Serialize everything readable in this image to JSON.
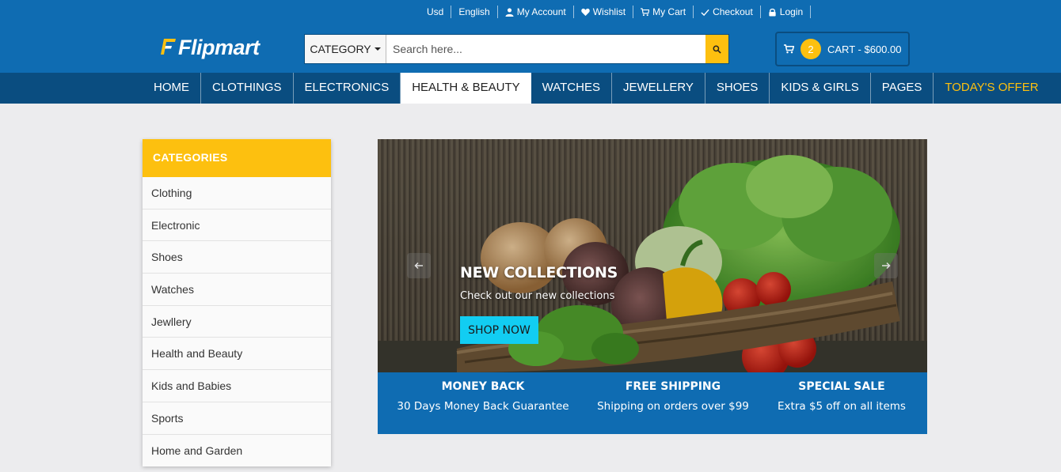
{
  "top_links": {
    "currency": "Usd",
    "language": "English",
    "my_account": "My Account",
    "wishlist": "Wishlist",
    "my_cart": "My Cart",
    "checkout": "Checkout",
    "login": "Login"
  },
  "logo": {
    "text": "Flipmart"
  },
  "search": {
    "category_label": "CATEGORY",
    "placeholder": "Search here..."
  },
  "cart": {
    "count": "2",
    "label": "CART - $600.00"
  },
  "nav": {
    "items": [
      "HOME",
      "CLOTHINGS",
      "ELECTRONICS",
      "HEALTH & BEAUTY",
      "WATCHES",
      "JEWELLERY",
      "SHOES",
      "KIDS & GIRLS",
      "PAGES",
      "TODAY'S OFFER"
    ],
    "active": "HEALTH & BEAUTY"
  },
  "sidebar": {
    "title": "CATEGORIES",
    "items": [
      "Clothing",
      "Electronic",
      "Shoes",
      "Watches",
      "Jewllery",
      "Health and Beauty",
      "Kids and Babies",
      "Sports",
      "Home and Garden"
    ]
  },
  "banner": {
    "title": "NEW COLLECTIONS",
    "subtitle": "Check out our new collections",
    "button": "SHOP NOW"
  },
  "info": {
    "items": [
      {
        "title": "MONEY BACK",
        "desc": "30 Days Money Back Guarantee"
      },
      {
        "title": "FREE SHIPPING",
        "desc": "Shipping on orders over $99"
      },
      {
        "title": "SPECIAL SALE",
        "desc": "Extra $5 off on all items"
      }
    ]
  },
  "colors": {
    "primary_blue": "#0f6cb2",
    "nav_blue": "#0a4d80",
    "accent_yellow": "#fdc00f",
    "button_cyan": "#12cdf2"
  },
  "icons": [
    "user-icon",
    "heart-icon",
    "cart-icon",
    "check-icon",
    "lock-icon",
    "search-icon",
    "chevron-left-icon",
    "chevron-right-icon"
  ]
}
